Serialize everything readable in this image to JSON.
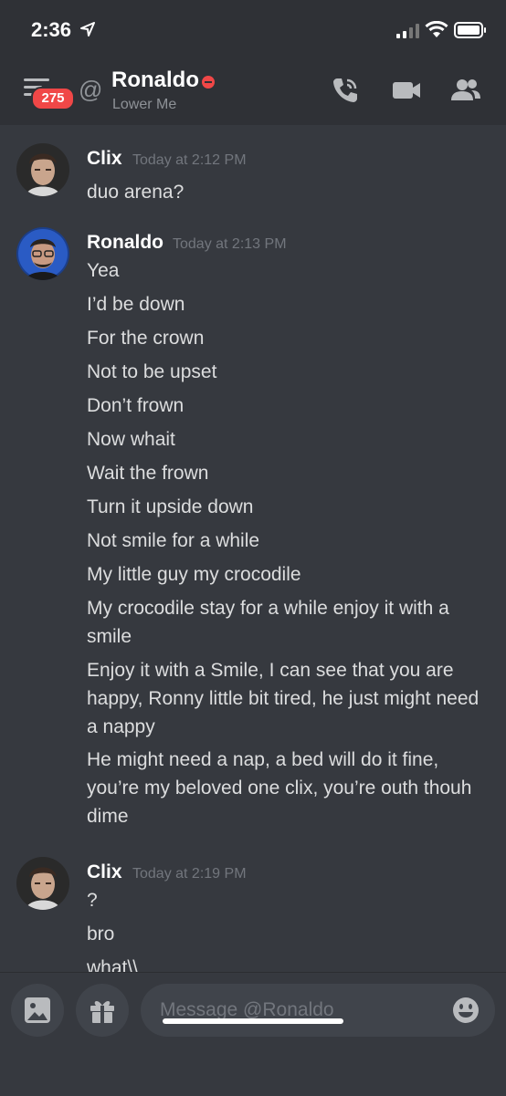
{
  "status_bar": {
    "time": "2:36"
  },
  "header": {
    "notification_count": "275",
    "channel_name": "Ronaldo",
    "channel_subtitle": "Lower Me"
  },
  "messages": [
    {
      "author": "Clix",
      "timestamp": "Today at 2:12 PM",
      "lines": [
        "duo arena?"
      ]
    },
    {
      "author": "Ronaldo",
      "timestamp": "Today at 2:13 PM",
      "lines": [
        "Yea",
        "I’d be down",
        "For the crown",
        "Not to be upset",
        "Don’t frown",
        "Now whait",
        "Wait the frown",
        "Turn it upside down",
        "Not smile for a while",
        "My little guy my crocodile",
        "My crocodile stay for a while enjoy it with a smile",
        "Enjoy it with a Smile, I can see that you are happy, Ronny little bit tired, he just might need a nappy",
        "He might need a nap, a bed will do it fine, you’re my beloved one clix, you’re outh thouh dime"
      ]
    },
    {
      "author": "Clix",
      "timestamp": "Today at 2:19 PM",
      "lines": [
        "?",
        "bro",
        "what\\\\"
      ]
    }
  ],
  "composer": {
    "placeholder": "Message @Ronaldo"
  },
  "colors": {
    "background": "#36393f",
    "header": "#2f3136",
    "badge": "#f04747",
    "dnd_status": "#f04747",
    "input": "#40444b"
  }
}
